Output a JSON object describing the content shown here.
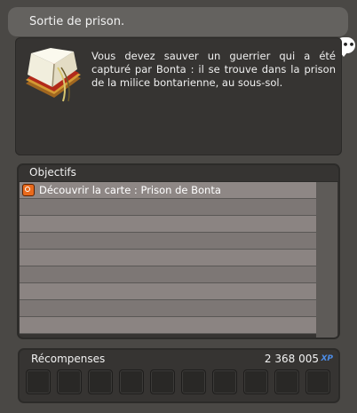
{
  "quest": {
    "title": "Sortie de prison.",
    "description": "Vous devez sauver un guerrier qui a été capturé par Bonta : il se trouve dans la prison de la milice bontarienne, au sous-sol.",
    "icon": "quest-book-icon"
  },
  "objectives": {
    "header": "Objectifs",
    "items": [
      {
        "label": "Découvrir la carte : Prison de Bonta",
        "icon": "objective-target-icon"
      }
    ]
  },
  "rewards": {
    "label": "Récompenses",
    "xp_value": "2 368 005",
    "xp_tag": "XP",
    "slots": 10
  },
  "colors": {
    "panel_bg": "#4a4845",
    "box_bg": "#363432",
    "row_bg": "#8b8482",
    "xp_accent": "#4c8ce6",
    "objective_icon": "#e96a1c"
  }
}
